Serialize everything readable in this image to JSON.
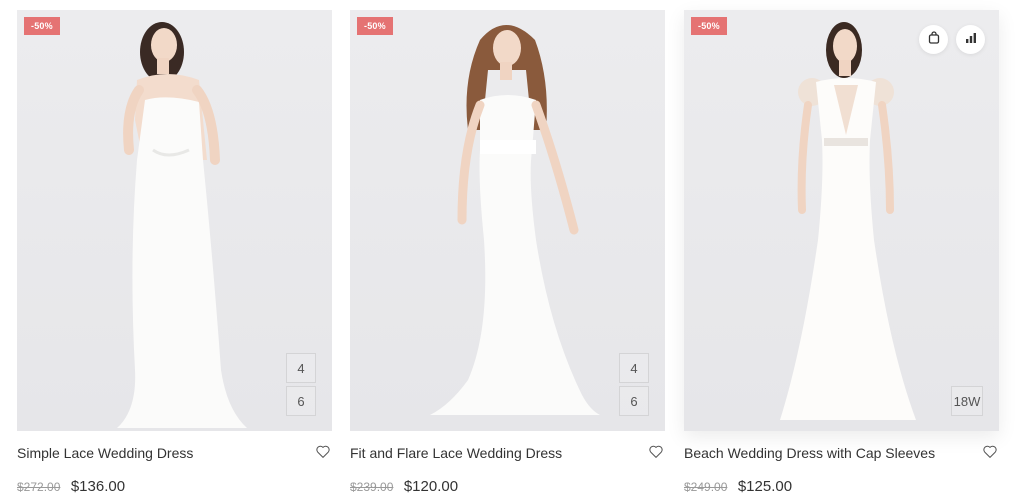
{
  "products": [
    {
      "badge": "-50%",
      "title": "Simple Lace Wedding Dress",
      "old_price": "$272.00",
      "price": "$136.00",
      "sizes": [
        "4",
        "6"
      ]
    },
    {
      "badge": "-50%",
      "title": "Fit and Flare Lace Wedding Dress",
      "old_price": "$239.00",
      "price": "$120.00",
      "sizes": [
        "4",
        "6"
      ]
    },
    {
      "badge": "-50%",
      "title": "Beach Wedding Dress with Cap Sleeves",
      "old_price": "$249.00",
      "price": "$125.00",
      "sizes": [
        "18W"
      ],
      "actions": [
        "shopping-bag-icon",
        "compare-chart-icon"
      ]
    }
  ],
  "colors": {
    "badge": "#e57373",
    "image_bg": "#ececee",
    "text": "#333333",
    "old_price": "#999999"
  }
}
